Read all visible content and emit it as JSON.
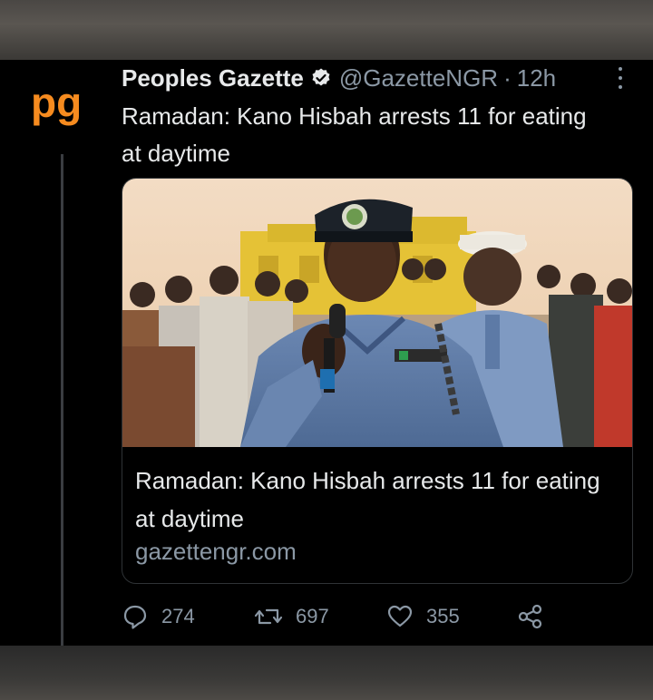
{
  "tweet": {
    "author_name": "Peoples Gazette",
    "handle": "@GazetteNGR",
    "separator": "·",
    "time": "12h",
    "avatar_text": "pg",
    "text": "Ramadan: Kano Hisbah arrests 11 for eating at daytime",
    "card": {
      "title": "Ramadan: Kano Hisbah arrests 11 for eating at daytime",
      "domain": "gazettengr.com",
      "image_icon": "photo-of-hisbah-officer-speaking-into-microphone"
    },
    "actions": {
      "replies": "274",
      "retweets": "697",
      "likes": "355"
    }
  },
  "colors": {
    "avatar_orange": "#f68b1f",
    "verified_badge": "#e7e9ea",
    "secondary_text": "#8b98a5"
  }
}
